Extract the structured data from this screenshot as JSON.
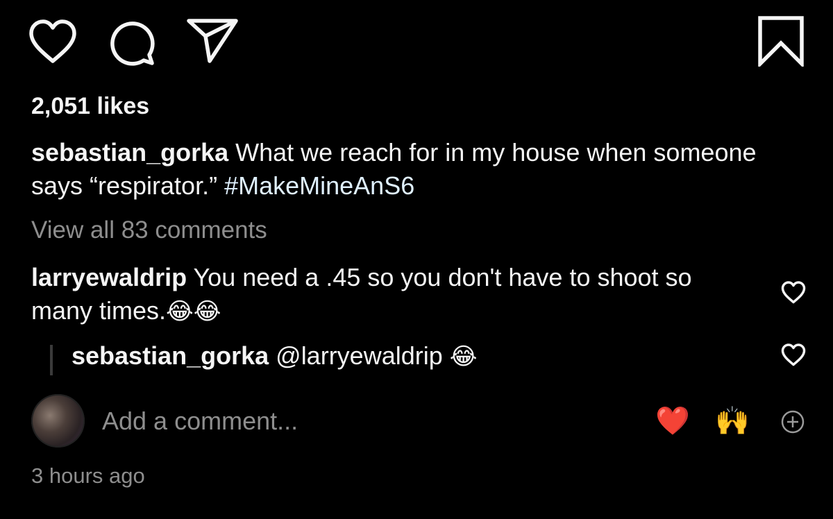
{
  "icons": {
    "like": "heart-outline-icon",
    "comment": "speech-bubble-icon",
    "share": "paper-plane-icon",
    "save": "bookmark-outline-icon",
    "add": "plus-circle-icon"
  },
  "post": {
    "likes": "2,051 likes",
    "caption": {
      "username": "sebastian_gorka",
      "text": " What we reach for in my house when someone says “respirator.” ",
      "hashtag": "#MakeMineAnS6"
    },
    "view_all": "View all 83 comments",
    "comments": [
      {
        "username": "larryewaldrip",
        "text": " You need a .45 so you don't have to shoot so many times.",
        "emojis": "😂😂",
        "replies": [
          {
            "username": "sebastian_gorka",
            "text": " @larryewaldrip ",
            "emojis": "😂"
          }
        ]
      }
    ],
    "add_comment_placeholder": "Add a comment...",
    "quick_reactions": [
      "❤️",
      "🙌"
    ],
    "timestamp": "3 hours ago"
  },
  "colors": {
    "background": "#000000",
    "text": "#f5f5f5",
    "muted": "#8e8e8e",
    "hashtag": "#e0f1ff"
  }
}
